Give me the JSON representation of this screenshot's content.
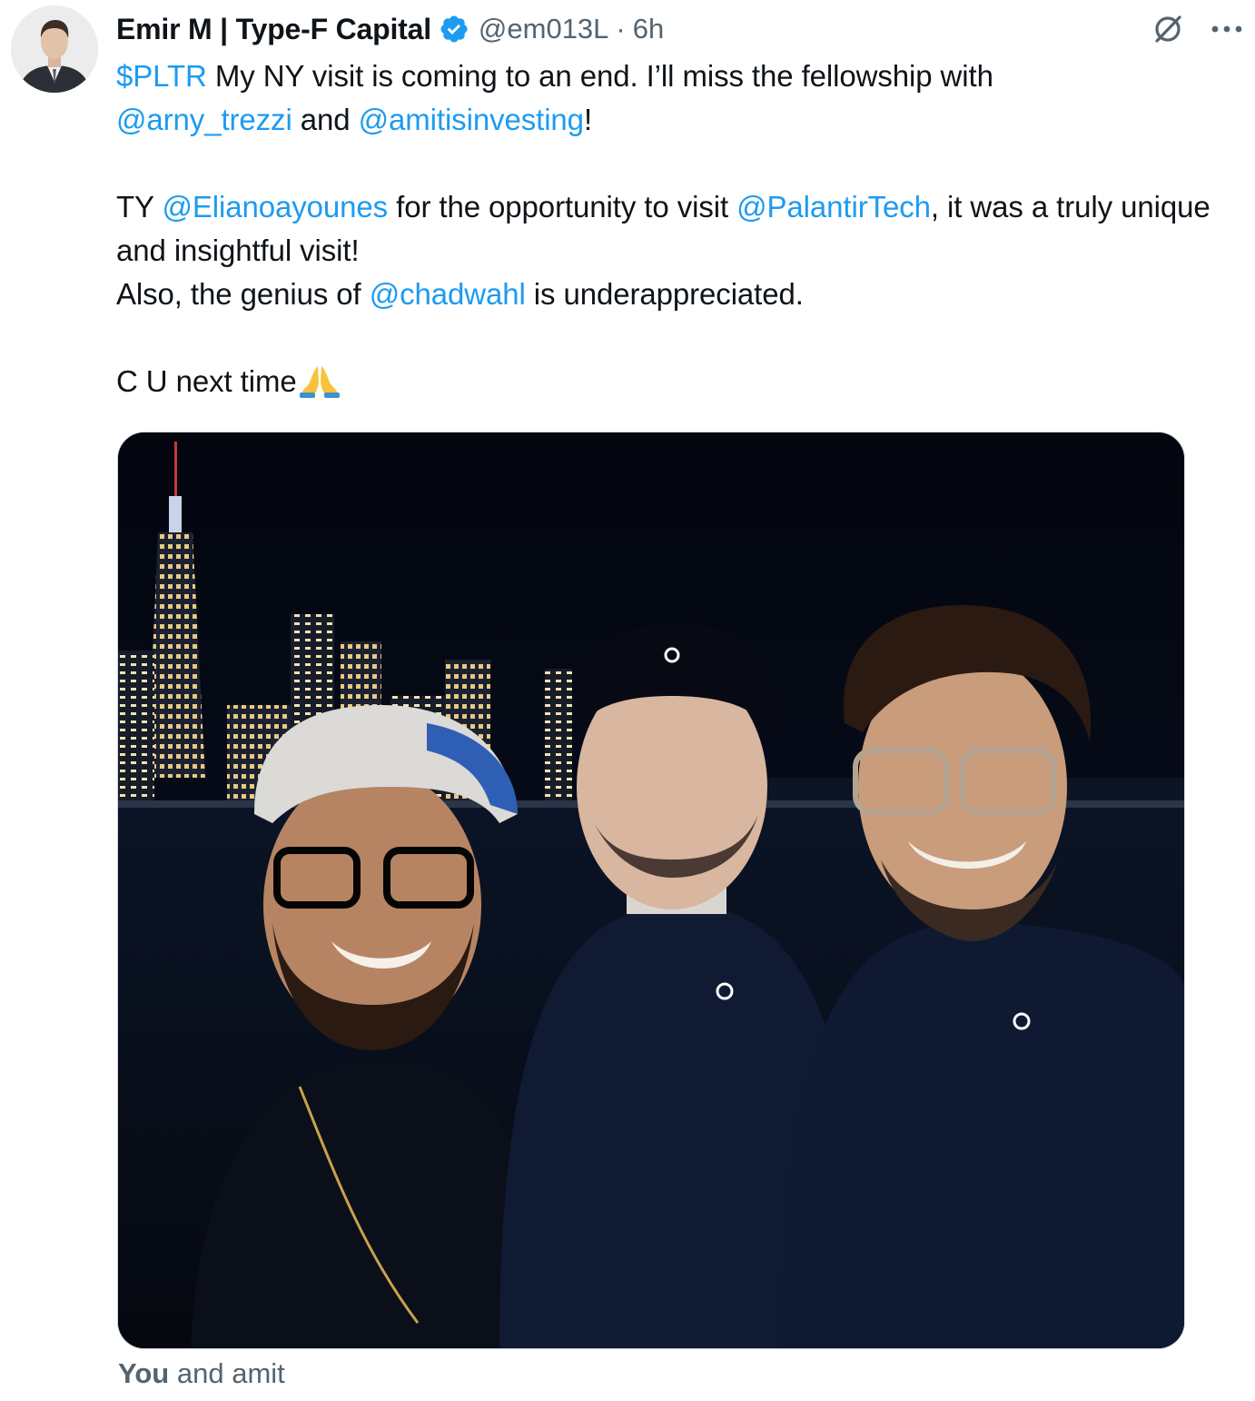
{
  "author": {
    "display_name": "Emir M | Type-F Capital",
    "handle": "@em013L",
    "separator": "·",
    "time": "6h",
    "verified": true,
    "avatar_icon": "person-portrait-avatar"
  },
  "tweet": {
    "cashtag": "$PLTR",
    "line1_rest": " My NY visit is coming to an end. I’ll miss the fellowship with",
    "mention1": "@arny_trezzi",
    "and_text": " and ",
    "mention2": "@amitisinvesting",
    "exclaim": "!",
    "ty_text": "TY ",
    "mention3": "@Elianoayounes",
    "for_text": " for the opportunity to visit ",
    "mention4": "@PalantirTech",
    "truly_text": ", it was a truly unique and insightful visit!",
    "also_text": "Also, the genius of ",
    "mention5": "@chadwahl",
    "underappreciated_text": " is underappreciated.",
    "closing_text": "C U next time",
    "closing_emoji": "folded-hands-emoji"
  },
  "media": {
    "kind": "photo",
    "description_icon": "night-city-selfie-photo"
  },
  "tagged": {
    "you_label": "You",
    "rest": " and amit"
  },
  "colors": {
    "link": "#1d9bf0",
    "text": "#0f1419",
    "secondary": "#536471",
    "verified_badge": "#1d9bf0"
  },
  "icons": {
    "grok": "grok-slash-icon",
    "more": "more-dots-icon",
    "verified": "verified-badge-icon"
  }
}
